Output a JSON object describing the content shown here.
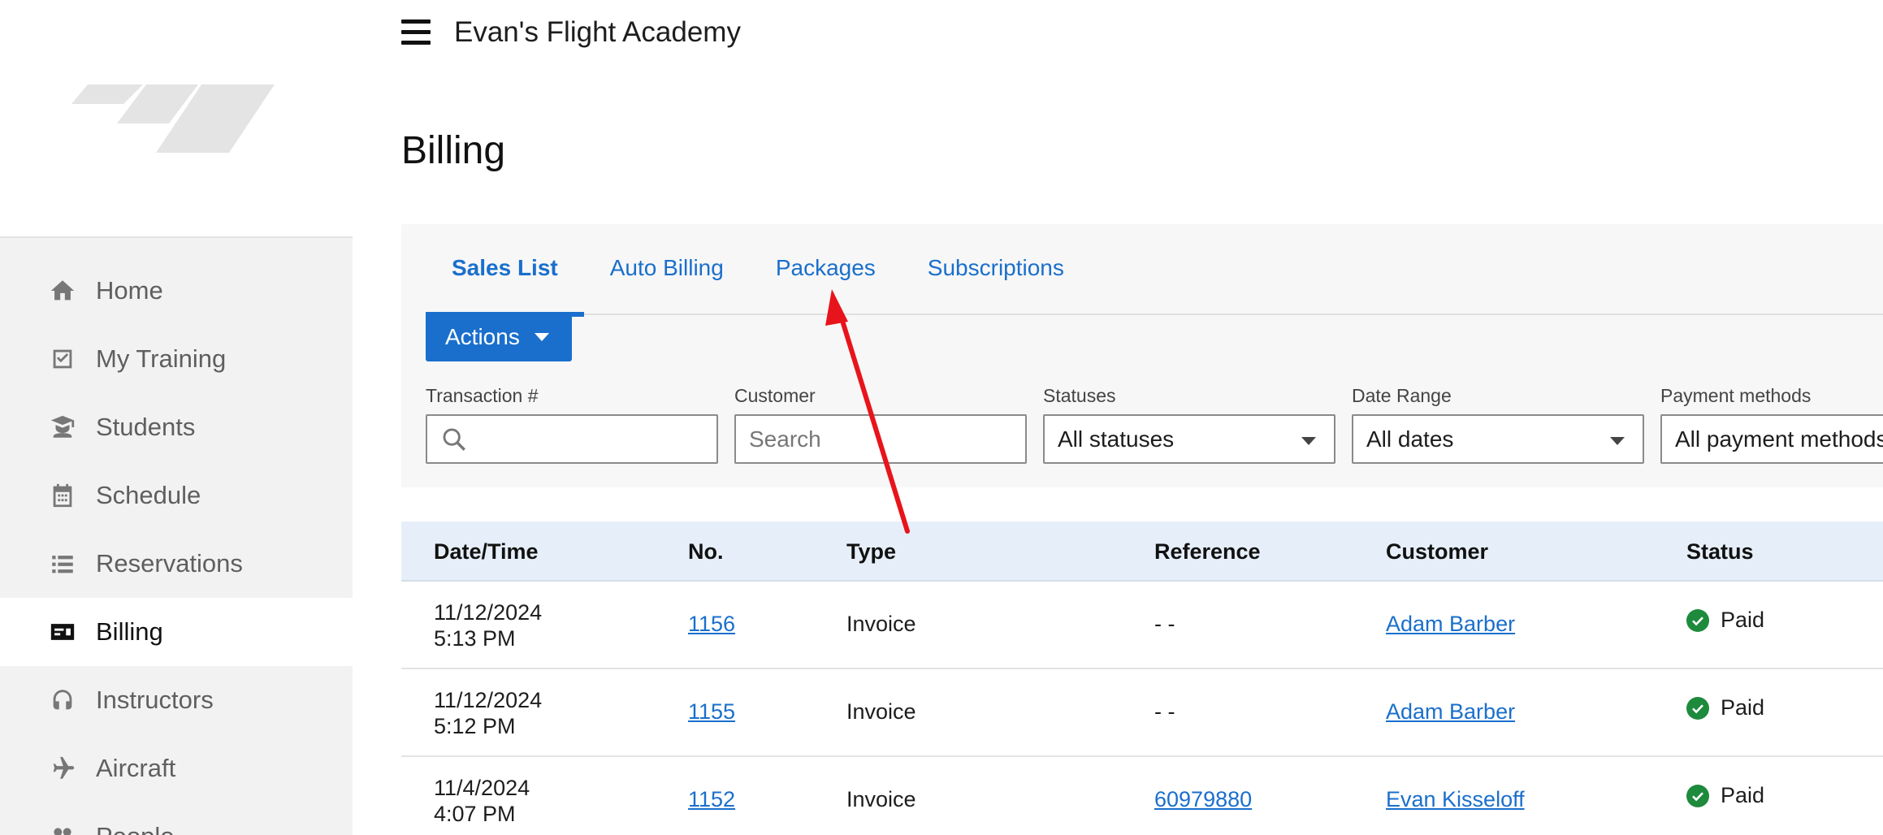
{
  "header": {
    "app_title": "Evan's Flight Academy",
    "page_title": "Billing"
  },
  "sidebar": {
    "items": [
      {
        "label": "Home",
        "icon": "home-icon"
      },
      {
        "label": "My Training",
        "icon": "checkbox-icon"
      },
      {
        "label": "Students",
        "icon": "student-icon"
      },
      {
        "label": "Schedule",
        "icon": "calendar-icon"
      },
      {
        "label": "Reservations",
        "icon": "list-icon"
      },
      {
        "label": "Billing",
        "icon": "billing-card-icon",
        "active": true
      },
      {
        "label": "Instructors",
        "icon": "headset-icon"
      },
      {
        "label": "Aircraft",
        "icon": "airplane-icon"
      },
      {
        "label": "People",
        "icon": "people-icon"
      }
    ]
  },
  "tabs": [
    {
      "label": "Sales List",
      "active": true
    },
    {
      "label": "Auto Billing"
    },
    {
      "label": "Packages"
    },
    {
      "label": "Subscriptions"
    }
  ],
  "actions": {
    "label": "Actions"
  },
  "filters": {
    "transaction": {
      "label": "Transaction #",
      "value": ""
    },
    "customer": {
      "label": "Customer",
      "placeholder": "Search"
    },
    "statuses": {
      "label": "Statuses",
      "value": "All statuses"
    },
    "date_range": {
      "label": "Date Range",
      "value": "All dates"
    },
    "payment_methods": {
      "label": "Payment methods",
      "value": "All payment methods"
    }
  },
  "table": {
    "headers": [
      "Date/Time",
      "No.",
      "Type",
      "Reference",
      "Customer",
      "Status"
    ],
    "rows": [
      {
        "date": "11/12/2024",
        "time": "5:13 PM",
        "no": "1156",
        "type": "Invoice",
        "reference": "- -",
        "reference_link": false,
        "customer": "Adam Barber",
        "status": "Paid"
      },
      {
        "date": "11/12/2024",
        "time": "5:12 PM",
        "no": "1155",
        "type": "Invoice",
        "reference": "- -",
        "reference_link": false,
        "customer": "Adam Barber",
        "status": "Paid"
      },
      {
        "date": "11/4/2024",
        "time": "4:07 PM",
        "no": "1152",
        "type": "Invoice",
        "reference": "60979880",
        "reference_link": true,
        "customer": "Evan Kisseloff",
        "status": "Paid"
      }
    ]
  },
  "colors": {
    "accent": "#1a6fcc",
    "annotation": "#e8141c",
    "paid": "#1e8a3c"
  }
}
